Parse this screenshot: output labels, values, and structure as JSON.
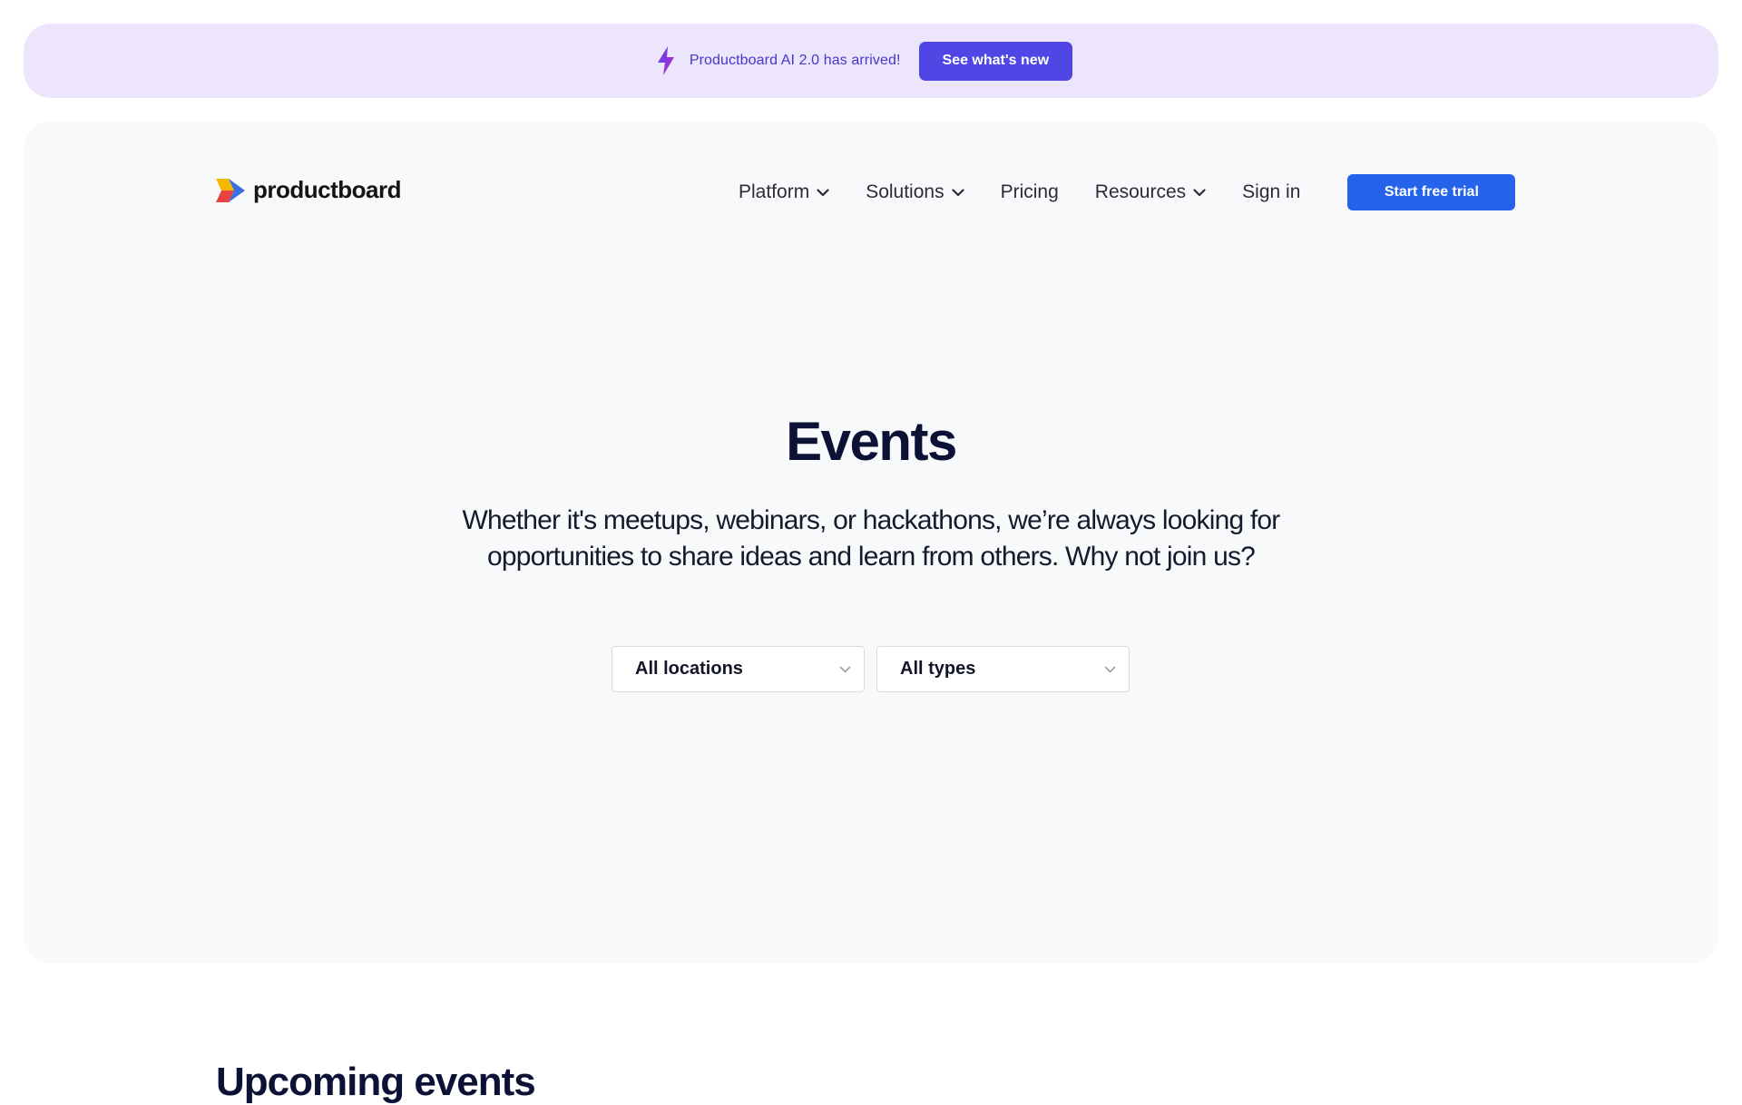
{
  "banner": {
    "icon": "lightning-bolt-icon",
    "text": "Productboard AI 2.0 has arrived!",
    "cta_label": "See what's new",
    "colors": {
      "background": "#ece5fb",
      "text": "#4338ca",
      "button": "#4f46e5"
    }
  },
  "header": {
    "logo_text": "productboard",
    "nav": [
      {
        "label": "Platform",
        "has_dropdown": true
      },
      {
        "label": "Solutions",
        "has_dropdown": true
      },
      {
        "label": "Pricing",
        "has_dropdown": false
      },
      {
        "label": "Resources",
        "has_dropdown": true
      },
      {
        "label": "Sign in",
        "has_dropdown": false
      }
    ],
    "cta_label": "Start free trial",
    "cta_color": "#2563eb"
  },
  "hero": {
    "title": "Events",
    "subtitle": "Whether it's meetups, webinars, or hackathons, we’re always looking for opportunities to share ideas and learn from others. Why not join us?",
    "filters": {
      "location": {
        "selected": "All locations"
      },
      "type": {
        "selected": "All types"
      }
    }
  },
  "upcoming": {
    "heading": "Upcoming events"
  }
}
